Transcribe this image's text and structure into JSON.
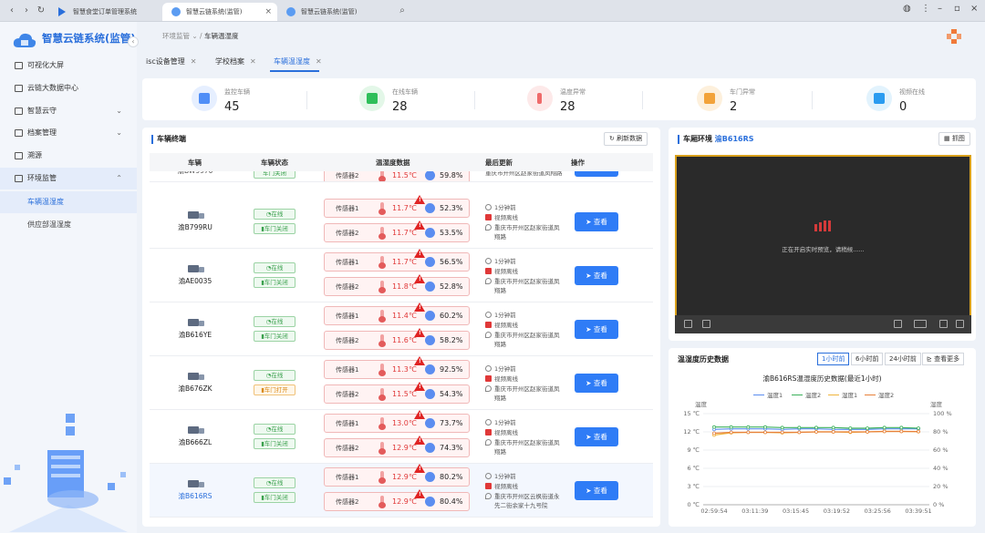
{
  "browser": {
    "tabs": [
      {
        "title": "智慧食堂订单管理系统",
        "active": false
      },
      {
        "title": "智慧云链系统(监管)",
        "active": true
      },
      {
        "title": "智慧云链系统(监管)",
        "active": false
      }
    ]
  },
  "sidebar": {
    "brand": "智慧云链系统(监管)",
    "items": [
      {
        "label": "可视化大屏"
      },
      {
        "label": "云链大数据中心"
      },
      {
        "label": "智慧云守"
      },
      {
        "label": "档案管理"
      },
      {
        "label": "溯源"
      },
      {
        "label": "环境监管"
      }
    ],
    "sub_items": [
      {
        "label": "车辆温湿度"
      },
      {
        "label": "供应部温湿度"
      }
    ]
  },
  "breadcrumb": {
    "parent": "环境监管",
    "current": "车辆温湿度"
  },
  "page_tabs": [
    {
      "label": "isc设备管理"
    },
    {
      "label": "学校档案"
    },
    {
      "label": "车辆温湿度"
    }
  ],
  "stats": [
    {
      "label": "监控车辆",
      "value": "45",
      "color": "#4f8ef7"
    },
    {
      "label": "在线车辆",
      "value": "28",
      "color": "#2fbf5a"
    },
    {
      "label": "温度异常",
      "value": "28",
      "color": "#ef6a6a"
    },
    {
      "label": "车门异常",
      "value": "2",
      "color": "#f2a33a"
    },
    {
      "label": "视频在线",
      "value": "0",
      "color": "#2b9cf0"
    }
  ],
  "vehicle_panel": {
    "title": "车辆终端",
    "refresh": "刷新数据",
    "columns": [
      "车辆",
      "车辆状态",
      "温湿度数据",
      "最后更新",
      "操作"
    ],
    "partial_row": {
      "plate": "渝BW9970",
      "door": "车门关闭",
      "sensor": "传感器2",
      "temp": "11.5℃",
      "hum": "59.8%",
      "address": "重庆市开州区赵家街道凤翔路"
    },
    "rows": [
      {
        "plate": "渝B799RU",
        "online": "在线",
        "door": "车门关闭",
        "door_warn": false,
        "s1": "传感器1",
        "t1": "11.7℃",
        "h1": "52.3%",
        "s2": "传感器2",
        "t2": "11.7℃",
        "h2": "53.5%",
        "time": "1分钟前",
        "video": "视频离线",
        "addr1": "重庆市开州区赵家街道凤",
        "addr2": "翔路",
        "action": "查看",
        "selected": false
      },
      {
        "plate": "渝AE0035",
        "online": "在线",
        "door": "车门关闭",
        "door_warn": false,
        "s1": "传感器1",
        "t1": "11.7℃",
        "h1": "56.5%",
        "s2": "传感器2",
        "t2": "11.8℃",
        "h2": "52.8%",
        "time": "1分钟前",
        "video": "视频离线",
        "addr1": "重庆市开州区赵家街道凤",
        "addr2": "翔路",
        "action": "查看",
        "selected": false
      },
      {
        "plate": "渝B616YE",
        "online": "在线",
        "door": "车门关闭",
        "door_warn": false,
        "s1": "传感器1",
        "t1": "11.4℃",
        "h1": "60.2%",
        "s2": "传感器2",
        "t2": "11.6℃",
        "h2": "58.2%",
        "time": "1分钟前",
        "video": "视频离线",
        "addr1": "重庆市开州区赵家街道凤",
        "addr2": "翔路",
        "action": "查看",
        "selected": false
      },
      {
        "plate": "渝B676ZK",
        "online": "在线",
        "door": "车门打开",
        "door_warn": true,
        "s1": "传感器1",
        "t1": "11.3℃",
        "h1": "92.5%",
        "s2": "传感器2",
        "t2": "11.5℃",
        "h2": "54.3%",
        "time": "1分钟前",
        "video": "视频离线",
        "addr1": "重庆市开州区赵家街道凤",
        "addr2": "翔路",
        "action": "查看",
        "selected": false
      },
      {
        "plate": "渝B666ZL",
        "online": "在线",
        "door": "车门关闭",
        "door_warn": false,
        "s1": "传感器1",
        "t1": "13.0℃",
        "h1": "73.7%",
        "s2": "传感器2",
        "t2": "12.9℃",
        "h2": "74.3%",
        "time": "1分钟前",
        "video": "视频离线",
        "addr1": "重庆市开州区赵家街道凤",
        "addr2": "翔路",
        "action": "查看",
        "selected": false
      },
      {
        "plate": "渝B616RS",
        "online": "在线",
        "door": "车门关闭",
        "door_warn": false,
        "s1": "传感器1",
        "t1": "12.9℃",
        "h1": "80.2%",
        "s2": "传感器2",
        "t2": "12.9℃",
        "h2": "80.4%",
        "time": "1分钟前",
        "video": "视频离线",
        "addr1": "重庆市开州区云枫街道永",
        "addr2": "先二街余家十九号院",
        "action": "查看",
        "selected": true
      }
    ]
  },
  "video_panel": {
    "title": "车厢环境",
    "plate": "渝B616RS",
    "button": "抓图",
    "status": "正在开启实时预览，请稍候......"
  },
  "history_panel": {
    "title": "温湿度历史数据",
    "ranges": [
      "1小时前",
      "6小时前",
      "24小时前"
    ],
    "more": "查看更多",
    "chart_title": "渝B616RS温湿度历史数据(最近1小时)"
  },
  "chart_data": {
    "type": "line",
    "title": "渝B616RS温湿度历史数据(最近1小时)",
    "ylabel_left": "温度",
    "ylabel_right": "湿度",
    "x": [
      "02:59:54",
      "03:11:39",
      "03:15:45",
      "03:19:52",
      "03:25:56",
      "03:39:51"
    ],
    "y_left_ticks": [
      "0 ℃",
      "3 ℃",
      "6 ℃",
      "9 ℃",
      "12 ℃",
      "15 ℃"
    ],
    "y_right_ticks": [
      "0 %",
      "20 %",
      "40 %",
      "60 %",
      "80 %",
      "100 %"
    ],
    "ylim_left": [
      0,
      15
    ],
    "ylim_right": [
      0,
      100
    ],
    "series": [
      {
        "name": "温度1",
        "axis": "left",
        "color": "#5b8def",
        "values": [
          12.4,
          12.5,
          12.5,
          12.5,
          12.4,
          12.5,
          12.5,
          12.4,
          12.4,
          12.4,
          12.5,
          12.5,
          12.5
        ]
      },
      {
        "name": "温度2",
        "axis": "left",
        "color": "#3cb15c",
        "values": [
          12.8,
          12.8,
          12.8,
          12.8,
          12.7,
          12.7,
          12.7,
          12.7,
          12.6,
          12.6,
          12.7,
          12.7,
          12.6
        ]
      },
      {
        "name": "湿度1",
        "axis": "right",
        "color": "#f0b53c",
        "values": [
          76.5,
          79.0,
          79.5,
          79.5,
          79.0,
          79.5,
          80.0,
          80.0,
          79.5,
          80.0,
          80.5,
          80.5,
          80.2
        ]
      },
      {
        "name": "湿度2",
        "axis": "right",
        "color": "#e8803a",
        "values": [
          78.5,
          79.5,
          79.5,
          79.5,
          79.5,
          79.5,
          80.0,
          80.0,
          80.0,
          80.0,
          80.5,
          80.5,
          80.4
        ]
      }
    ]
  }
}
